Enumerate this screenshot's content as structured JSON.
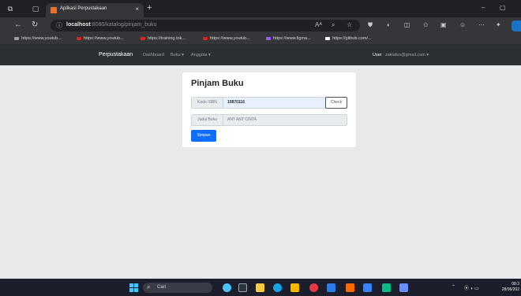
{
  "browser": {
    "tab_title": "Aplikasi Perpustakaan",
    "tab_close": "×",
    "new_tab": "+",
    "url_host": "localhost",
    "url_path": ":8080/katalog/pinjam_buku",
    "bookmarks": [
      {
        "label": "https://www.youtub...",
        "color": "#9aa0a6"
      },
      {
        "label": "https://www.youtub...",
        "color": "#e62117"
      },
      {
        "label": "https://training.tok...",
        "color": "#e62117"
      },
      {
        "label": "https://www.youtub...",
        "color": "#e62117"
      },
      {
        "label": "https://www.figma...",
        "color": "#a259ff"
      },
      {
        "label": "https://github.com/...",
        "color": "#ffffff"
      }
    ]
  },
  "app": {
    "brand": "Perpustakaan",
    "nav": [
      "Dashboard",
      "Buku ▾",
      "Anggota ▾"
    ],
    "user_label": "User",
    "user_email": "zakiatus@gmail.com ▾"
  },
  "form": {
    "title": "Pinjam Buku",
    "isbn_label": "Kode ISBN",
    "isbn_value": "10870116",
    "check_label": "Check",
    "judul_label": "Judul Buku",
    "judul_value": "ANT ANT CINTA",
    "submit_label": "Simpan"
  },
  "taskbar": {
    "search_label": "Cari",
    "clock_time": "08:3",
    "clock_date": "28/06/202",
    "app_colors": [
      "#4cc2ff",
      "#f7c948",
      "#2a8be8",
      "#1aa1e6",
      "#f5b800",
      "#e63946",
      "#2d7be5",
      "#ff6a00",
      "#3b82f6",
      "#10b981",
      "#6b8cff"
    ]
  },
  "colors": {
    "accent": "#0d6efd",
    "navbar": "#2b3035",
    "page_bg": "#e9e9ec"
  }
}
